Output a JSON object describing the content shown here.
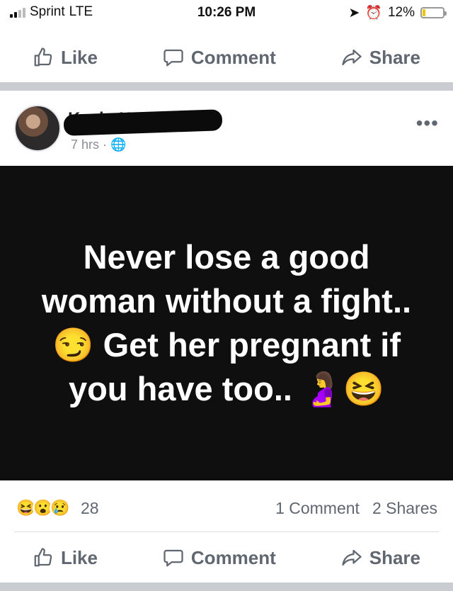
{
  "status_bar": {
    "carrier": "Sprint",
    "network": "LTE",
    "time": "10:26 PM",
    "battery": "12%",
    "battery_level": 0.12
  },
  "actions": {
    "like": "Like",
    "comment": "Comment",
    "share": "Share"
  },
  "post": {
    "author": "Kevin Herwig",
    "time": "7 hrs",
    "image_text": "Never lose a good woman without a fight..😏 Get her pregnant if you have too.. 🤰😆"
  },
  "reactions": {
    "count": "28",
    "comments": "1 Comment",
    "shares": "2 Shares",
    "icons": [
      "😆",
      "😮",
      "😢"
    ]
  },
  "colors": {
    "action_text": "#606770",
    "divider": "#c9ccd1",
    "image_bg": "#0f0f0f"
  }
}
